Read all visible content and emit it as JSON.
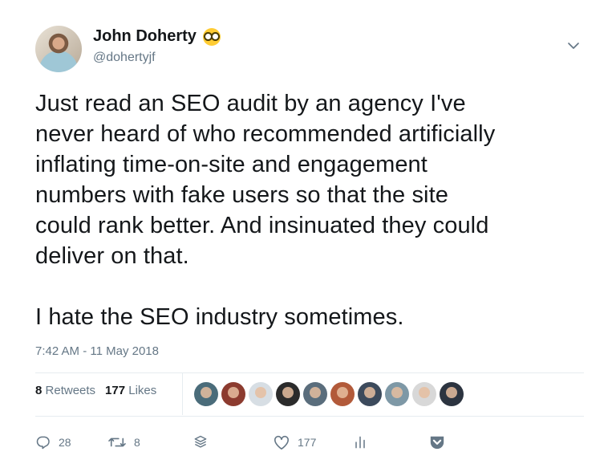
{
  "author": {
    "name": "John Doherty",
    "handle": "@dohertyjf",
    "badge_emoji": "nerd-face-icon"
  },
  "tweet": {
    "text": "Just read an SEO audit by an agency I've\nnever heard of who recommended artificially\ninflating time-on-site and engagement\nnumbers with fake users so that the site\ncould rank better. And insinuated they could\ndeliver on that.\n\nI hate the SEO industry sometimes.",
    "timestamp": "7:42 AM - 11 May 2018"
  },
  "stats": {
    "retweets_count": "8",
    "retweets_label": "Retweets",
    "likes_count": "177",
    "likes_label": "Likes"
  },
  "actions": {
    "reply_count": "28",
    "retweet_count": "8",
    "like_count": "177"
  },
  "colors": {
    "text": "#14171a",
    "secondary": "#657786",
    "icon": "#657786",
    "divider": "#e6ecf0"
  }
}
